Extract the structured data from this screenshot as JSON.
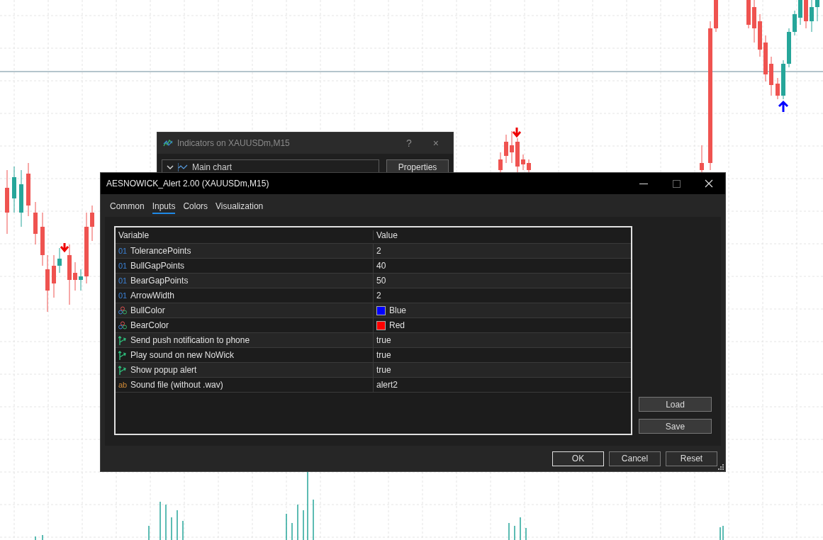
{
  "back_window": {
    "title": "Indicators on XAUUSDm,M15",
    "help": "?",
    "close": "×",
    "dropdown": {
      "value": "Main chart"
    },
    "properties_button": "Properties"
  },
  "window": {
    "title": "AESNOWICK_Alert 2.00 (XAUUSDm,M15)"
  },
  "tabs": [
    {
      "label": "Common",
      "selected": false
    },
    {
      "label": "Inputs",
      "selected": true
    },
    {
      "label": "Colors",
      "selected": false
    },
    {
      "label": "Visualization",
      "selected": false
    }
  ],
  "table": {
    "columns": [
      "Variable",
      "Value"
    ],
    "rows": [
      {
        "kind": "int",
        "type_glyph": "01",
        "variable": "TolerancePoints",
        "value": "2"
      },
      {
        "kind": "int",
        "type_glyph": "01",
        "variable": "BullGapPoints",
        "value": "40"
      },
      {
        "kind": "int",
        "type_glyph": "01",
        "variable": "BearGapPoints",
        "value": "50"
      },
      {
        "kind": "int",
        "type_glyph": "01",
        "variable": "ArrowWidth",
        "value": "2"
      },
      {
        "kind": "color",
        "variable": "BullColor",
        "value": "Blue",
        "color": "#0000ff"
      },
      {
        "kind": "color",
        "variable": "BearColor",
        "value": "Red",
        "color": "#ff0000"
      },
      {
        "kind": "bool",
        "variable": "Send push notification to phone",
        "value": "true"
      },
      {
        "kind": "bool",
        "variable": "Play sound on new NoWick",
        "value": "true"
      },
      {
        "kind": "bool",
        "variable": "Show popup alert",
        "value": "true"
      },
      {
        "kind": "string",
        "type_glyph": "ab",
        "variable": "Sound file (without .wav)",
        "value": "alert2"
      }
    ]
  },
  "side_buttons": [
    "Load",
    "Save"
  ],
  "footer_buttons": [
    {
      "label": "OK",
      "default": true
    },
    {
      "label": "Cancel",
      "default": false
    },
    {
      "label": "Reset",
      "default": false
    }
  ]
}
